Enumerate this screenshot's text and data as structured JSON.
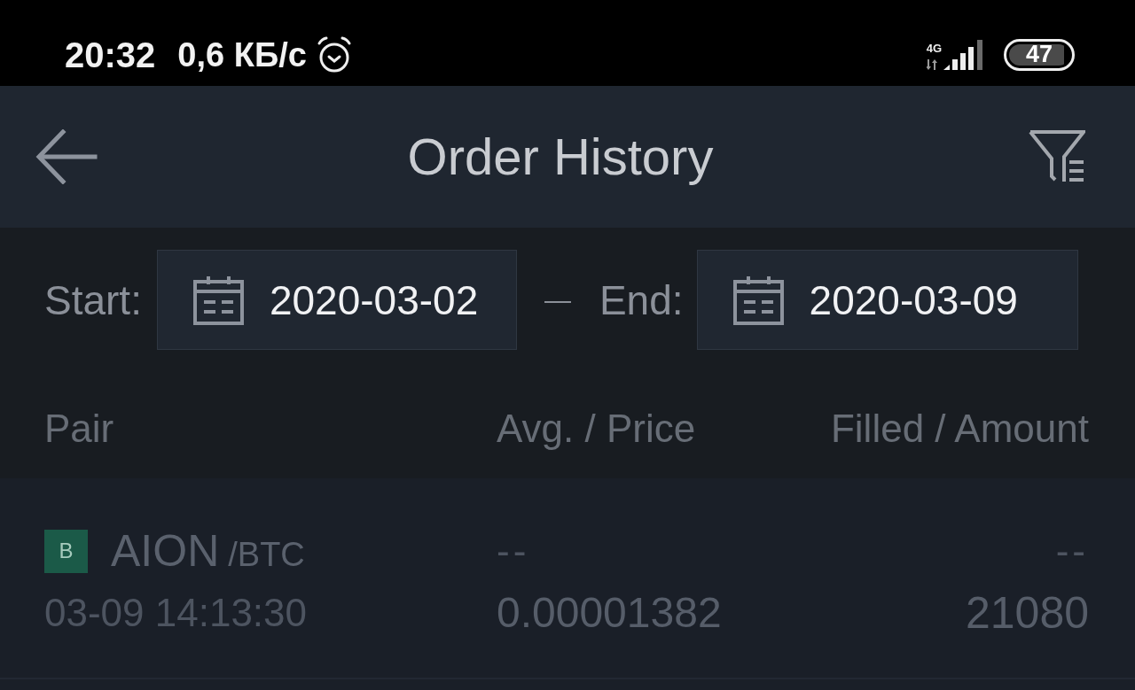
{
  "status_bar": {
    "time": "20:32",
    "speed": "0,6 КБ/с",
    "network": "4G",
    "battery": "47"
  },
  "header": {
    "title": "Order History"
  },
  "date_range": {
    "start_label": "Start:",
    "start": "2020-03-02",
    "separator": "—",
    "end_label": "End:",
    "end": "2020-03-09"
  },
  "table": {
    "columns": [
      "Pair",
      "Avg. / Price",
      "Filled / Amount"
    ],
    "rows": [
      {
        "badge": {
          "text": "B",
          "color": "#1b5a48"
        },
        "base": "AION",
        "quote": "/BTC",
        "time": "03-09 14:13:30",
        "avg": "--",
        "price": "0.00001382",
        "filled": "--",
        "amount": "21080"
      }
    ]
  }
}
